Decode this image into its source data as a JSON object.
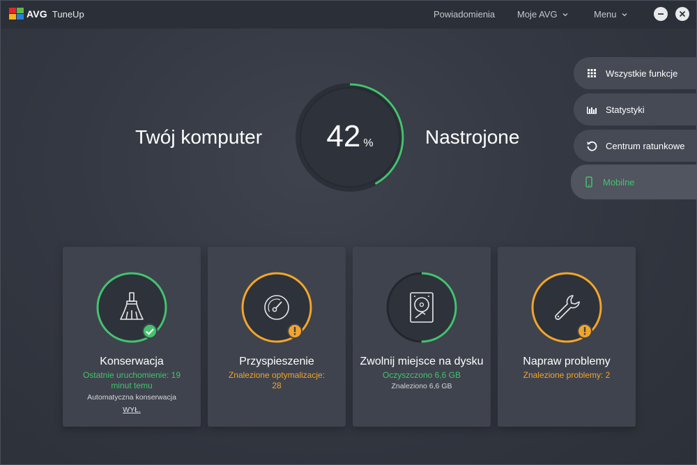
{
  "app": {
    "brand": "AVG",
    "product": "TuneUp"
  },
  "nav": {
    "notifications": "Powiadomienia",
    "my_avg": "Moje AVG",
    "menu": "Menu"
  },
  "score": {
    "left_label": "Twój komputer",
    "value": "42",
    "unit": "%",
    "fraction": 0.42,
    "right_label": "Nastrojone"
  },
  "side_menu": [
    {
      "label": "Wszystkie funkcje",
      "icon": "grid-icon"
    },
    {
      "label": "Statystyki",
      "icon": "bar-chart-icon"
    },
    {
      "label": "Centrum ratunkowe",
      "icon": "undo-icon"
    },
    {
      "label": "Mobilne",
      "icon": "phone-icon"
    }
  ],
  "cards": [
    {
      "title": "Konserwacja",
      "status": "Ostatnie uruchomienie: 19 minut temu",
      "detail": "Automatyczna konserwacja",
      "link": "WYŁ.",
      "icon": "broom-icon",
      "badge": "check-icon"
    },
    {
      "title": "Przyspieszenie",
      "status": "Znalezione optymalizacje: 28",
      "icon": "speedometer-icon",
      "badge": "warning-icon"
    },
    {
      "title": "Zwolnij miejsce na dysku",
      "status": "Oczyszczono 6,6 GB",
      "detail": "Znaleziono 6,6 GB",
      "icon": "hard-drive-icon"
    },
    {
      "title": "Napraw problemy",
      "status": "Znalezione problemy: 2",
      "icon": "wrench-icon",
      "badge": "warning-icon"
    }
  ],
  "colors": {
    "green": "#43c36f",
    "orange": "#f2a52b",
    "background": "#343842",
    "card": "#3f434d"
  }
}
